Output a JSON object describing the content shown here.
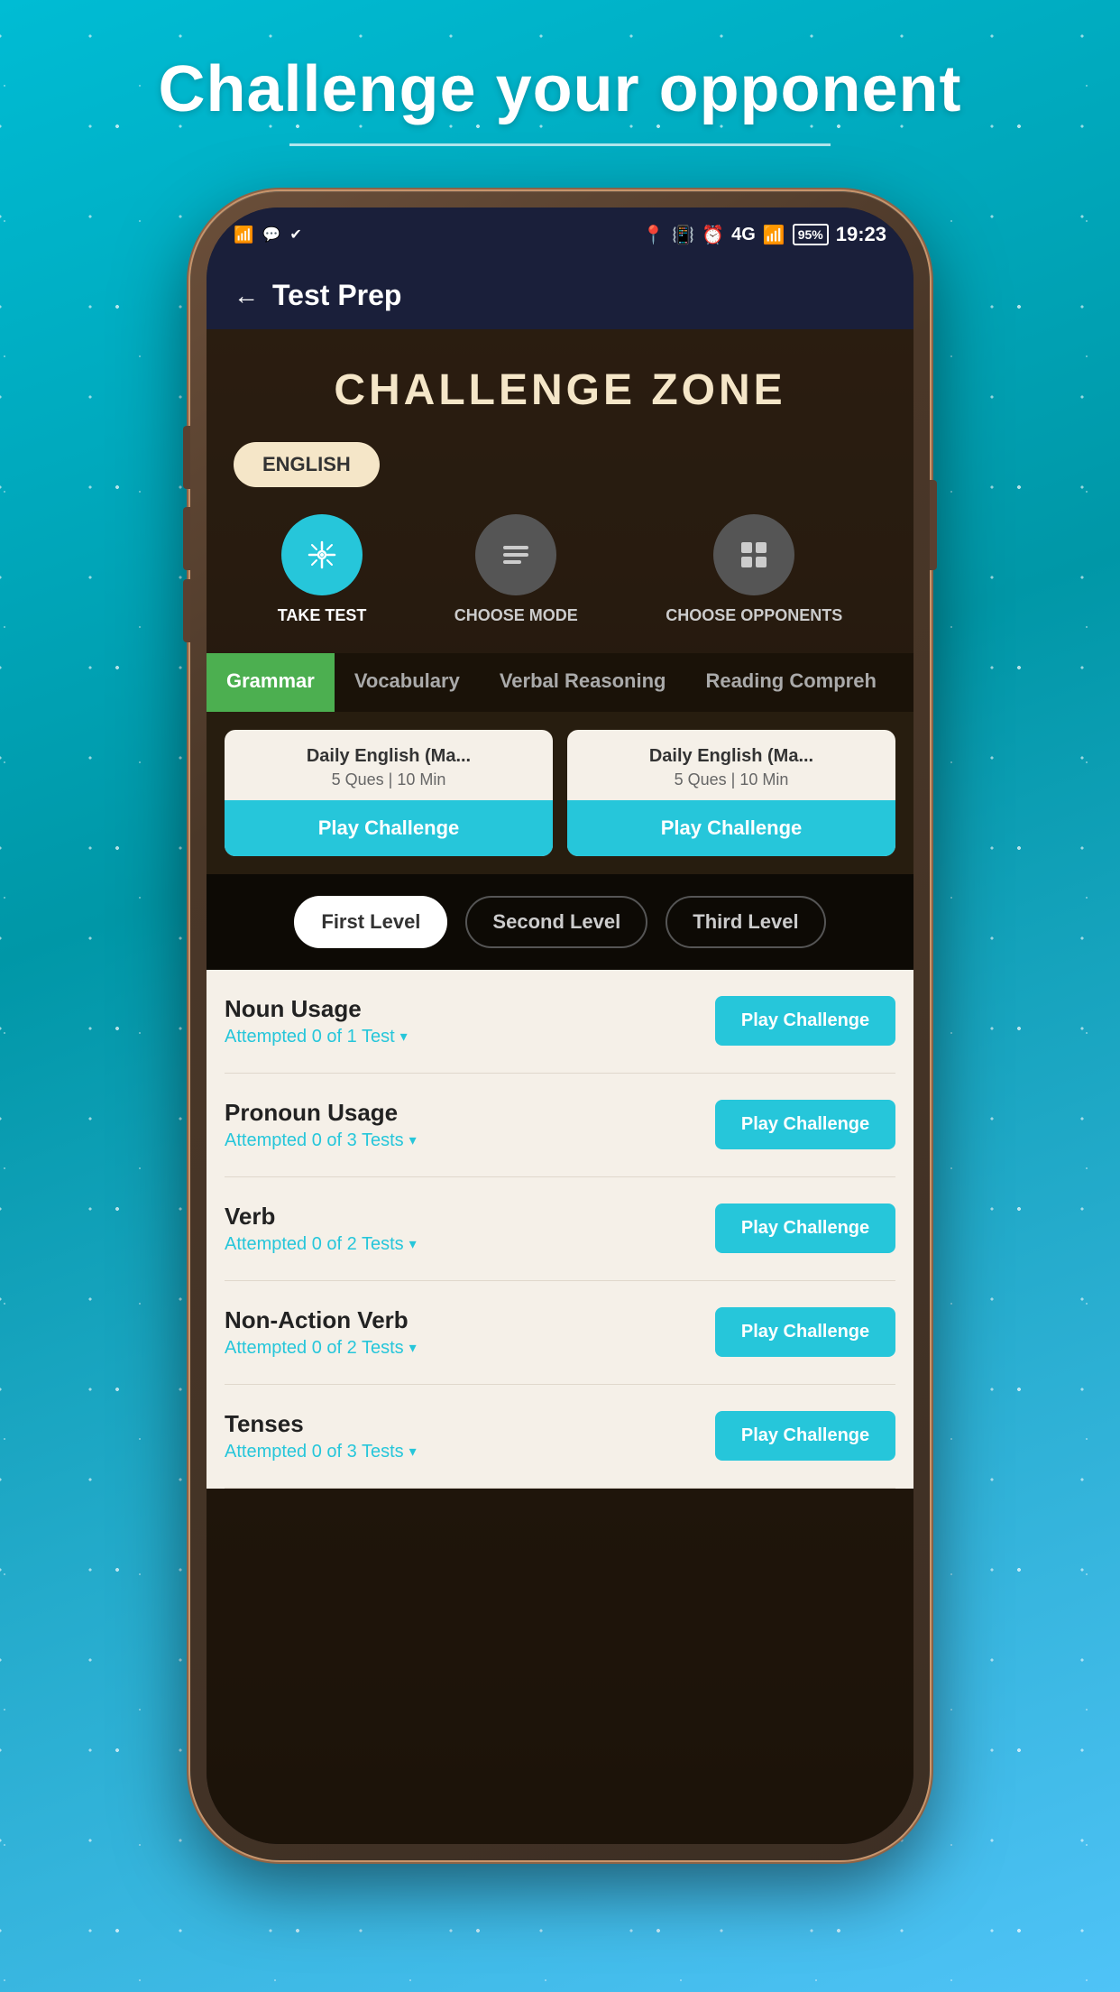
{
  "page": {
    "bg_title": "Challenge your opponent",
    "title_underline": true
  },
  "status_bar": {
    "time": "19:23",
    "battery_percent": "95%",
    "signal_label": "4G"
  },
  "nav": {
    "back_label": "←",
    "title": "Test Prep"
  },
  "challenge_zone": {
    "title": "CHALLENGE ZONE",
    "subject_pill": "ENGLISH"
  },
  "mode_icons": [
    {
      "id": "take-test",
      "label": "TAKE TEST",
      "icon": "⊞",
      "active": true
    },
    {
      "id": "choose-mode",
      "label": "CHOOSE MODE",
      "icon": "☰",
      "active": false
    },
    {
      "id": "choose-opponents",
      "label": "CHOOSE OPPONENTS",
      "icon": "⊞",
      "active": false
    }
  ],
  "subject_tabs": [
    {
      "label": "Grammar",
      "active": true
    },
    {
      "label": "Vocabulary",
      "active": false
    },
    {
      "label": "Verbal Reasoning",
      "active": false
    },
    {
      "label": "Reading Compreh",
      "active": false
    }
  ],
  "daily_cards": [
    {
      "title": "Daily English (Ma...",
      "meta": "5 Ques | 10 Min",
      "btn_label": "Play Challenge"
    },
    {
      "title": "Daily English (Ma...",
      "meta": "5 Ques | 10 Min",
      "btn_label": "Play Challenge"
    }
  ],
  "level_tabs": [
    {
      "label": "First Level",
      "active": true
    },
    {
      "label": "Second Level",
      "active": false
    },
    {
      "label": "Third Level",
      "active": false
    }
  ],
  "topics": [
    {
      "name": "Noun Usage",
      "attempted": "Attempted 0 of 1 Test",
      "btn_label": "Play Challenge"
    },
    {
      "name": "Pronoun Usage",
      "attempted": "Attempted 0 of 3 Tests",
      "btn_label": "Play Challenge"
    },
    {
      "name": "Verb",
      "attempted": "Attempted 0 of 2 Tests",
      "btn_label": "Play Challenge"
    },
    {
      "name": "Non-Action Verb",
      "attempted": "Attempted 0 of 2 Tests",
      "btn_label": "Play Challenge"
    },
    {
      "name": "Tenses",
      "attempted": "Attempted 0 of 3 Tests",
      "btn_label": "Play Challenge"
    }
  ]
}
